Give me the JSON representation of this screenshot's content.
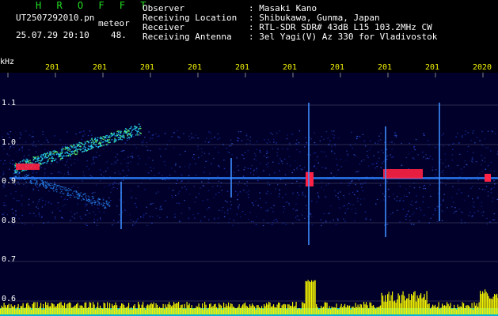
{
  "header": {
    "brand": "H R O F F T",
    "filename": "UT2507292010.pn",
    "suffix": "meteor",
    "timestamp": "25.07.29 20:10",
    "stamp_number": "48.",
    "info": [
      {
        "label": "Observer",
        "value": ": Masaki Kano"
      },
      {
        "label": "Receiving Location",
        "value": ": Shibukawa, Gunma, Japan"
      },
      {
        "label": "Receiver",
        "value": ": RTL-SDR SDR# 43dB L15 103.2MHz CW"
      },
      {
        "label": "Receiving Antenna",
        "value": ": 3el Yagi(V) Az 330 for Vladivostok"
      }
    ]
  },
  "axis": {
    "unit": "kHz",
    "y_labels": [
      "1.1",
      "1.0",
      "0.9",
      "0.8",
      "0.7",
      "0.6"
    ],
    "x_ticks": [
      "201",
      "201",
      "201",
      "201",
      "201",
      "201",
      "201",
      "201",
      "201",
      "2020"
    ]
  },
  "colors": {
    "text_green": "#22dd22",
    "text_white": "#ffffff",
    "tick_yellow": "#f2f200",
    "signal_red": "#ff2244",
    "background": "#000000"
  }
}
